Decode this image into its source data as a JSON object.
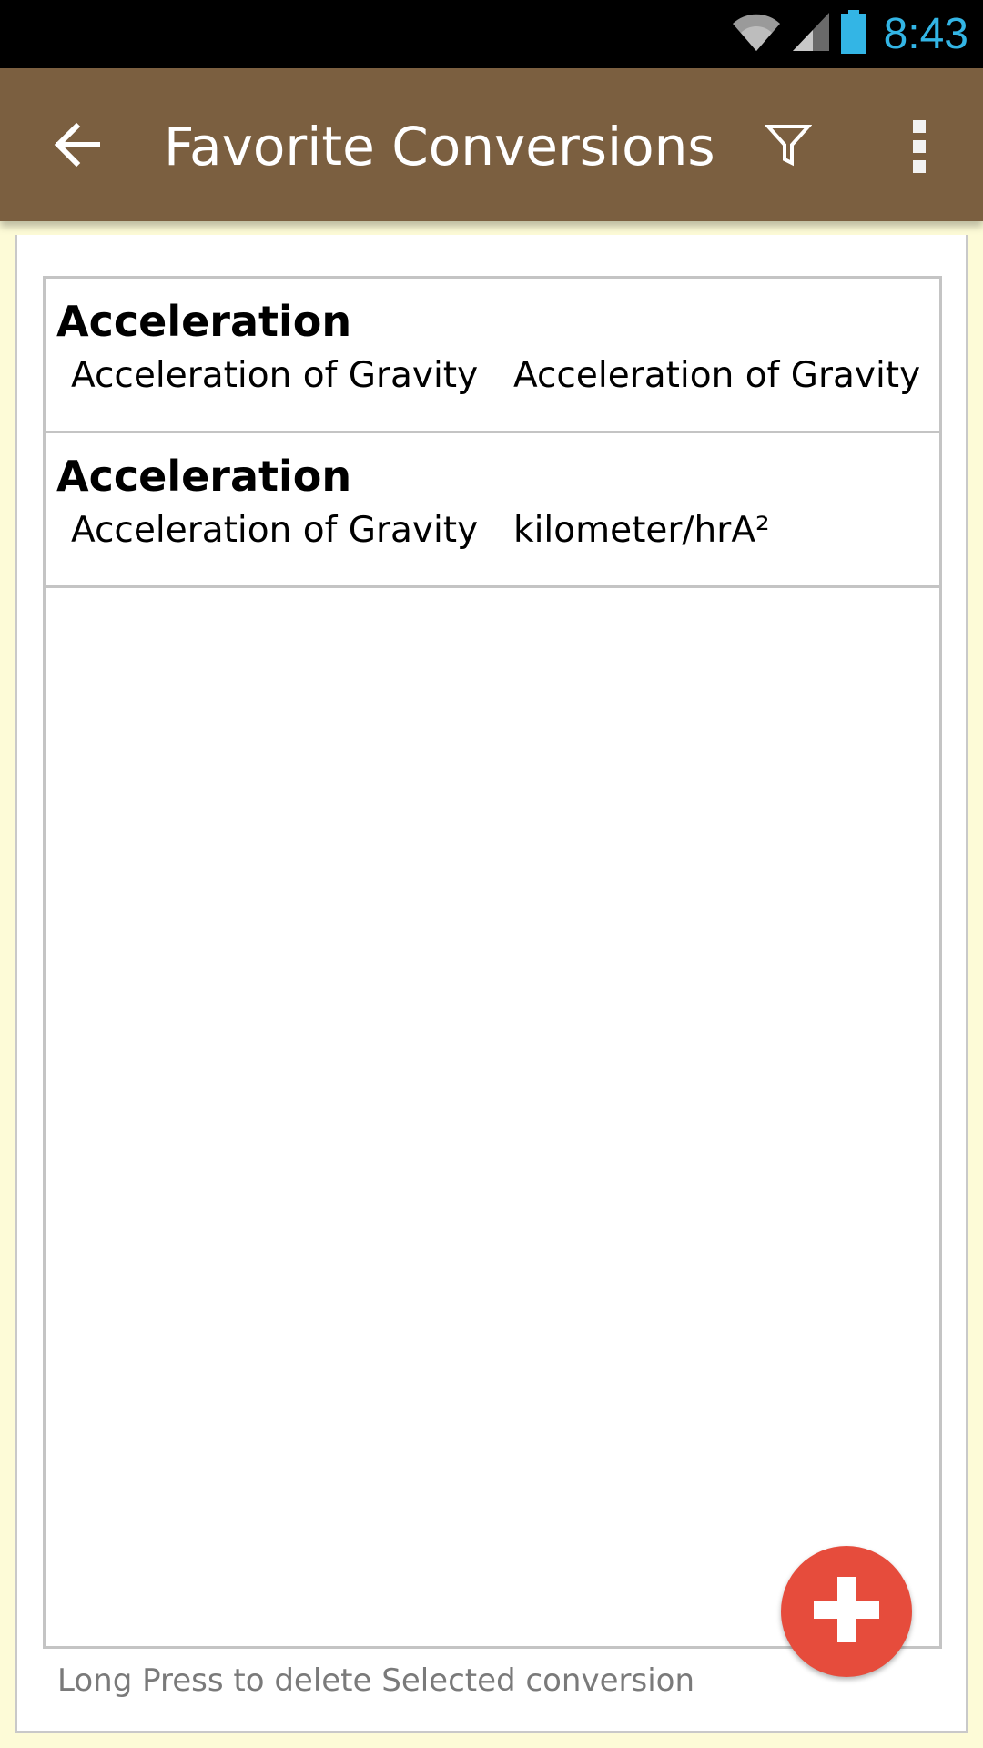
{
  "status_bar": {
    "time": "8:43",
    "icons": [
      "wifi-icon",
      "cell-signal-icon",
      "battery-icon"
    ],
    "time_color": "#33b5e5"
  },
  "app_bar": {
    "title": "Favorite Conversions",
    "background_color": "#7b5f40",
    "icons": [
      "back-arrow-icon",
      "filter-icon",
      "overflow-menu-icon"
    ]
  },
  "favorites": [
    {
      "category": "Acceleration",
      "from_unit": "Acceleration of Gravity",
      "to_unit": "Acceleration of Gravity"
    },
    {
      "category": "Acceleration",
      "from_unit": "Acceleration of Gravity",
      "to_unit": "kilometer/hrA²"
    }
  ],
  "footer": {
    "hint": "Long Press to delete Selected conversion"
  },
  "fab": {
    "icon": "plus-icon",
    "color": "#e64c3c"
  }
}
